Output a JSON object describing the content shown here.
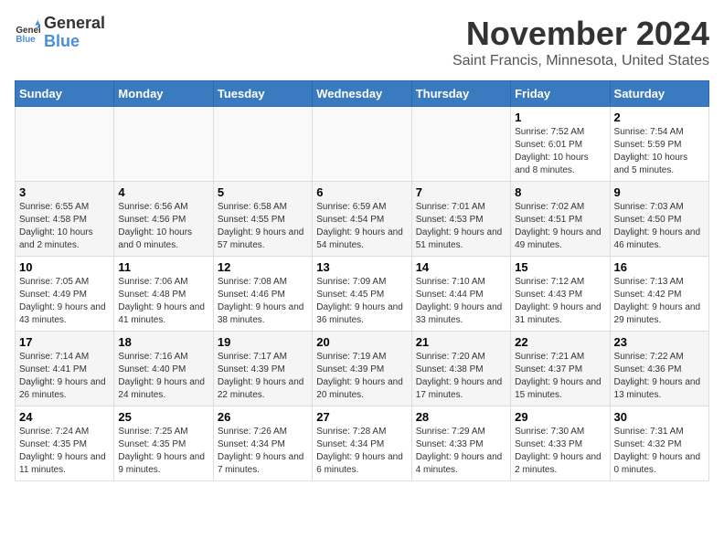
{
  "logo": {
    "general": "General",
    "blue": "Blue"
  },
  "header": {
    "month": "November 2024",
    "location": "Saint Francis, Minnesota, United States"
  },
  "days_of_week": [
    "Sunday",
    "Monday",
    "Tuesday",
    "Wednesday",
    "Thursday",
    "Friday",
    "Saturday"
  ],
  "weeks": [
    [
      {
        "day": "",
        "info": ""
      },
      {
        "day": "",
        "info": ""
      },
      {
        "day": "",
        "info": ""
      },
      {
        "day": "",
        "info": ""
      },
      {
        "day": "",
        "info": ""
      },
      {
        "day": "1",
        "info": "Sunrise: 7:52 AM\nSunset: 6:01 PM\nDaylight: 10 hours and 8 minutes."
      },
      {
        "day": "2",
        "info": "Sunrise: 7:54 AM\nSunset: 5:59 PM\nDaylight: 10 hours and 5 minutes."
      }
    ],
    [
      {
        "day": "3",
        "info": "Sunrise: 6:55 AM\nSunset: 4:58 PM\nDaylight: 10 hours and 2 minutes."
      },
      {
        "day": "4",
        "info": "Sunrise: 6:56 AM\nSunset: 4:56 PM\nDaylight: 10 hours and 0 minutes."
      },
      {
        "day": "5",
        "info": "Sunrise: 6:58 AM\nSunset: 4:55 PM\nDaylight: 9 hours and 57 minutes."
      },
      {
        "day": "6",
        "info": "Sunrise: 6:59 AM\nSunset: 4:54 PM\nDaylight: 9 hours and 54 minutes."
      },
      {
        "day": "7",
        "info": "Sunrise: 7:01 AM\nSunset: 4:53 PM\nDaylight: 9 hours and 51 minutes."
      },
      {
        "day": "8",
        "info": "Sunrise: 7:02 AM\nSunset: 4:51 PM\nDaylight: 9 hours and 49 minutes."
      },
      {
        "day": "9",
        "info": "Sunrise: 7:03 AM\nSunset: 4:50 PM\nDaylight: 9 hours and 46 minutes."
      }
    ],
    [
      {
        "day": "10",
        "info": "Sunrise: 7:05 AM\nSunset: 4:49 PM\nDaylight: 9 hours and 43 minutes."
      },
      {
        "day": "11",
        "info": "Sunrise: 7:06 AM\nSunset: 4:48 PM\nDaylight: 9 hours and 41 minutes."
      },
      {
        "day": "12",
        "info": "Sunrise: 7:08 AM\nSunset: 4:46 PM\nDaylight: 9 hours and 38 minutes."
      },
      {
        "day": "13",
        "info": "Sunrise: 7:09 AM\nSunset: 4:45 PM\nDaylight: 9 hours and 36 minutes."
      },
      {
        "day": "14",
        "info": "Sunrise: 7:10 AM\nSunset: 4:44 PM\nDaylight: 9 hours and 33 minutes."
      },
      {
        "day": "15",
        "info": "Sunrise: 7:12 AM\nSunset: 4:43 PM\nDaylight: 9 hours and 31 minutes."
      },
      {
        "day": "16",
        "info": "Sunrise: 7:13 AM\nSunset: 4:42 PM\nDaylight: 9 hours and 29 minutes."
      }
    ],
    [
      {
        "day": "17",
        "info": "Sunrise: 7:14 AM\nSunset: 4:41 PM\nDaylight: 9 hours and 26 minutes."
      },
      {
        "day": "18",
        "info": "Sunrise: 7:16 AM\nSunset: 4:40 PM\nDaylight: 9 hours and 24 minutes."
      },
      {
        "day": "19",
        "info": "Sunrise: 7:17 AM\nSunset: 4:39 PM\nDaylight: 9 hours and 22 minutes."
      },
      {
        "day": "20",
        "info": "Sunrise: 7:19 AM\nSunset: 4:39 PM\nDaylight: 9 hours and 20 minutes."
      },
      {
        "day": "21",
        "info": "Sunrise: 7:20 AM\nSunset: 4:38 PM\nDaylight: 9 hours and 17 minutes."
      },
      {
        "day": "22",
        "info": "Sunrise: 7:21 AM\nSunset: 4:37 PM\nDaylight: 9 hours and 15 minutes."
      },
      {
        "day": "23",
        "info": "Sunrise: 7:22 AM\nSunset: 4:36 PM\nDaylight: 9 hours and 13 minutes."
      }
    ],
    [
      {
        "day": "24",
        "info": "Sunrise: 7:24 AM\nSunset: 4:35 PM\nDaylight: 9 hours and 11 minutes."
      },
      {
        "day": "25",
        "info": "Sunrise: 7:25 AM\nSunset: 4:35 PM\nDaylight: 9 hours and 9 minutes."
      },
      {
        "day": "26",
        "info": "Sunrise: 7:26 AM\nSunset: 4:34 PM\nDaylight: 9 hours and 7 minutes."
      },
      {
        "day": "27",
        "info": "Sunrise: 7:28 AM\nSunset: 4:34 PM\nDaylight: 9 hours and 6 minutes."
      },
      {
        "day": "28",
        "info": "Sunrise: 7:29 AM\nSunset: 4:33 PM\nDaylight: 9 hours and 4 minutes."
      },
      {
        "day": "29",
        "info": "Sunrise: 7:30 AM\nSunset: 4:33 PM\nDaylight: 9 hours and 2 minutes."
      },
      {
        "day": "30",
        "info": "Sunrise: 7:31 AM\nSunset: 4:32 PM\nDaylight: 9 hours and 0 minutes."
      }
    ]
  ]
}
